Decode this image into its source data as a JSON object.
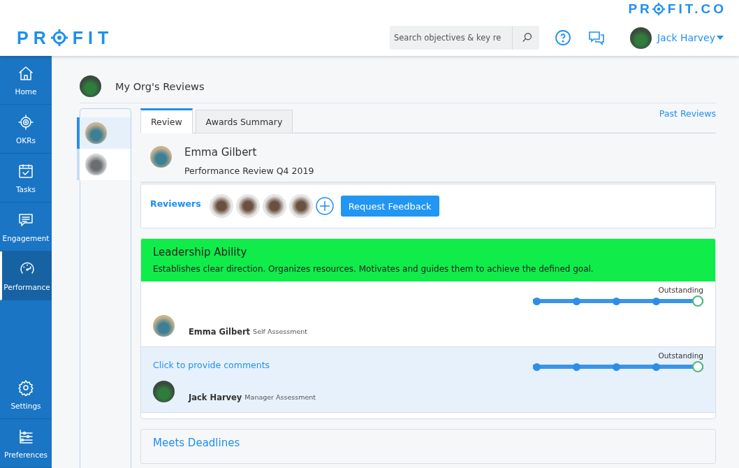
{
  "brand": {
    "corner_logo": {
      "before": "PR",
      "after": "FIT.CO"
    },
    "logo": {
      "before": "PR",
      "after": "FIT"
    }
  },
  "header": {
    "search": {
      "placeholder": "Search objectives & key re"
    },
    "user": "Jack Harvey"
  },
  "nav": {
    "main": [
      {
        "label": "Home",
        "selected": false
      },
      {
        "label": "OKRs",
        "selected": false
      },
      {
        "label": "Tasks",
        "selected": false
      },
      {
        "label": "Engagement",
        "selected": false
      },
      {
        "label": "Performance",
        "selected": true
      }
    ],
    "bottom": [
      {
        "label": "Settings",
        "selected": false
      },
      {
        "label": "Preferences",
        "selected": false
      }
    ]
  },
  "page": {
    "title": "My Org's Reviews"
  },
  "people": [
    {
      "selected": true
    },
    {
      "selected": false
    }
  ],
  "tabs": [
    {
      "label": "Review",
      "selected": true
    },
    {
      "label": "Awards Summary",
      "selected": false
    }
  ],
  "past_reviews": "Past Reviews",
  "review": {
    "name": "Emma Gilbert",
    "subtitle": "Performance Review Q4 2019"
  },
  "reviewers": {
    "label": "Reviewers",
    "button": "Request Feedback"
  },
  "competencies": [
    {
      "title": "Leadership Ability",
      "description": "Establishes clear direction. Organizes resources. Motivates and guides them to achieve the defined goal.",
      "color": "#10ec4a",
      "assessments": [
        {
          "kind": "self",
          "rating_label": "Outstanding",
          "points": [
            {
              "selected": false
            },
            {
              "selected": false
            },
            {
              "selected": false
            },
            {
              "selected": false
            },
            {
              "selected": true
            }
          ],
          "name": "Emma Gilbert",
          "role": "Self Assessment"
        },
        {
          "kind": "manager",
          "prompt": "Click to provide comments",
          "rating_label": "Outstanding",
          "points": [
            {
              "selected": false
            },
            {
              "selected": false
            },
            {
              "selected": false
            },
            {
              "selected": false
            },
            {
              "selected": true
            }
          ],
          "name": "Jack Harvey",
          "role": "Manager Assessment"
        }
      ]
    },
    {
      "title": "Meets Deadlines"
    }
  ]
}
